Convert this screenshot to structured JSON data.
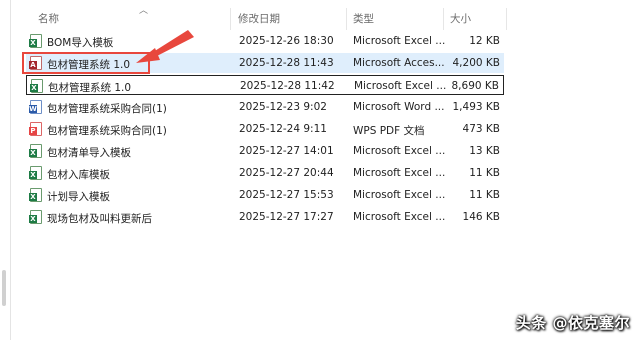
{
  "columns": {
    "name": "名称",
    "date": "修改日期",
    "type": "类型",
    "size": "大小"
  },
  "files": [
    {
      "name": "BOM导入模板",
      "date": "2025-12-26 18:30",
      "type": "Microsoft Excel ...",
      "size": "12 KB",
      "icon": "excel-file-icon"
    },
    {
      "name": "包材管理系统 1.0",
      "date": "2025-12-28 11:43",
      "type": "Microsoft Acces...",
      "size": "4,200 KB",
      "icon": "access-file-icon"
    },
    {
      "name": "包材管理系统 1.0",
      "date": "2025-12-28 11:42",
      "type": "Microsoft Excel ...",
      "size": "8,690 KB",
      "icon": "excel-file-icon"
    },
    {
      "name": "包材管理系统采购合同(1)",
      "date": "2025-12-23 9:02",
      "type": "Microsoft Word ...",
      "size": "1,493 KB",
      "icon": "word-file-icon"
    },
    {
      "name": "包材管理系统采购合同(1)",
      "date": "2025-12-24 9:11",
      "type": "WPS PDF 文档",
      "size": "473 KB",
      "icon": "wps-pdf-file-icon"
    },
    {
      "name": "包材清单导入模板",
      "date": "2025-12-27 14:01",
      "type": "Microsoft Excel ...",
      "size": "13 KB",
      "icon": "excel-file-icon"
    },
    {
      "name": "包材入库模板",
      "date": "2025-12-27 20:44",
      "type": "Microsoft Excel ...",
      "size": "11 KB",
      "icon": "excel-file-icon"
    },
    {
      "name": "计划导入模板",
      "date": "2025-12-27 15:53",
      "type": "Microsoft Excel ...",
      "size": "11 KB",
      "icon": "excel-file-icon"
    },
    {
      "name": "现场包材及叫料更新后",
      "date": "2025-12-27 17:27",
      "type": "Microsoft Excel ...",
      "size": "146 KB",
      "icon": "excel-file-icon"
    }
  ],
  "watermark": "头条 @依克塞尔",
  "colors": {
    "annotation": "#e8473d",
    "selection": "#dfeefc"
  }
}
